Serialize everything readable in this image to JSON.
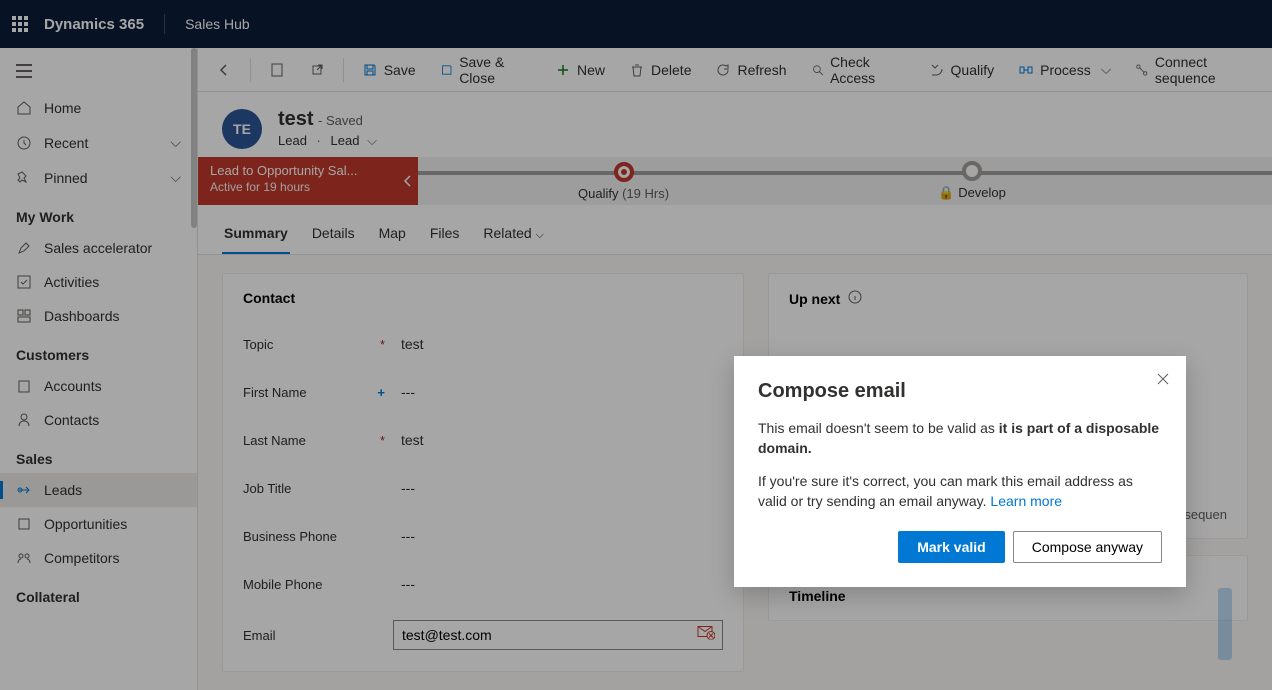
{
  "topbar": {
    "brand": "Dynamics 365",
    "app": "Sales Hub"
  },
  "sidebar": {
    "home": "Home",
    "recent": "Recent",
    "pinned": "Pinned",
    "mywork_header": "My Work",
    "sales_accel": "Sales accelerator",
    "activities": "Activities",
    "dashboards": "Dashboards",
    "customers_header": "Customers",
    "accounts": "Accounts",
    "contacts": "Contacts",
    "sales_header": "Sales",
    "leads": "Leads",
    "opportunities": "Opportunities",
    "competitors": "Competitors",
    "collateral_header": "Collateral"
  },
  "commands": {
    "save": "Save",
    "saveclose": "Save & Close",
    "new": "New",
    "delete": "Delete",
    "refresh": "Refresh",
    "checkaccess": "Check Access",
    "qualify": "Qualify",
    "process": "Process",
    "connect_seq": "Connect sequence"
  },
  "record": {
    "avatar": "TE",
    "title": "test",
    "saved": "- Saved",
    "entity": "Lead",
    "form": "Lead"
  },
  "bpf": {
    "name": "Lead to Opportunity Sal...",
    "active": "Active for 19 hours",
    "stage1": "Qualify",
    "stage1_dur": "(19 Hrs)",
    "stage2": "Develop"
  },
  "tabs": {
    "summary": "Summary",
    "details": "Details",
    "map": "Map",
    "files": "Files",
    "related": "Related"
  },
  "contact": {
    "header": "Contact",
    "topic_label": "Topic",
    "topic_value": "test",
    "firstname_label": "First Name",
    "firstname_value": "---",
    "lastname_label": "Last Name",
    "lastname_value": "test",
    "jobtitle_label": "Job Title",
    "jobtitle_value": "---",
    "bphone_label": "Business Phone",
    "bphone_value": "---",
    "mphone_label": "Mobile Phone",
    "mphone_value": "---",
    "email_label": "Email",
    "email_value": "test@test.com"
  },
  "upnext": {
    "header": "Up next",
    "guided": "guided sequen"
  },
  "timeline": {
    "header": "Timeline"
  },
  "dialog": {
    "title": "Compose email",
    "p1a": "This email doesn't seem to be valid as ",
    "p1b": "it is part of a disposable domain.",
    "p2": "If you're sure it's correct, you can mark this email address as valid or try sending an email anyway. ",
    "learn": "Learn more",
    "mark": "Mark valid",
    "compose": "Compose anyway"
  }
}
